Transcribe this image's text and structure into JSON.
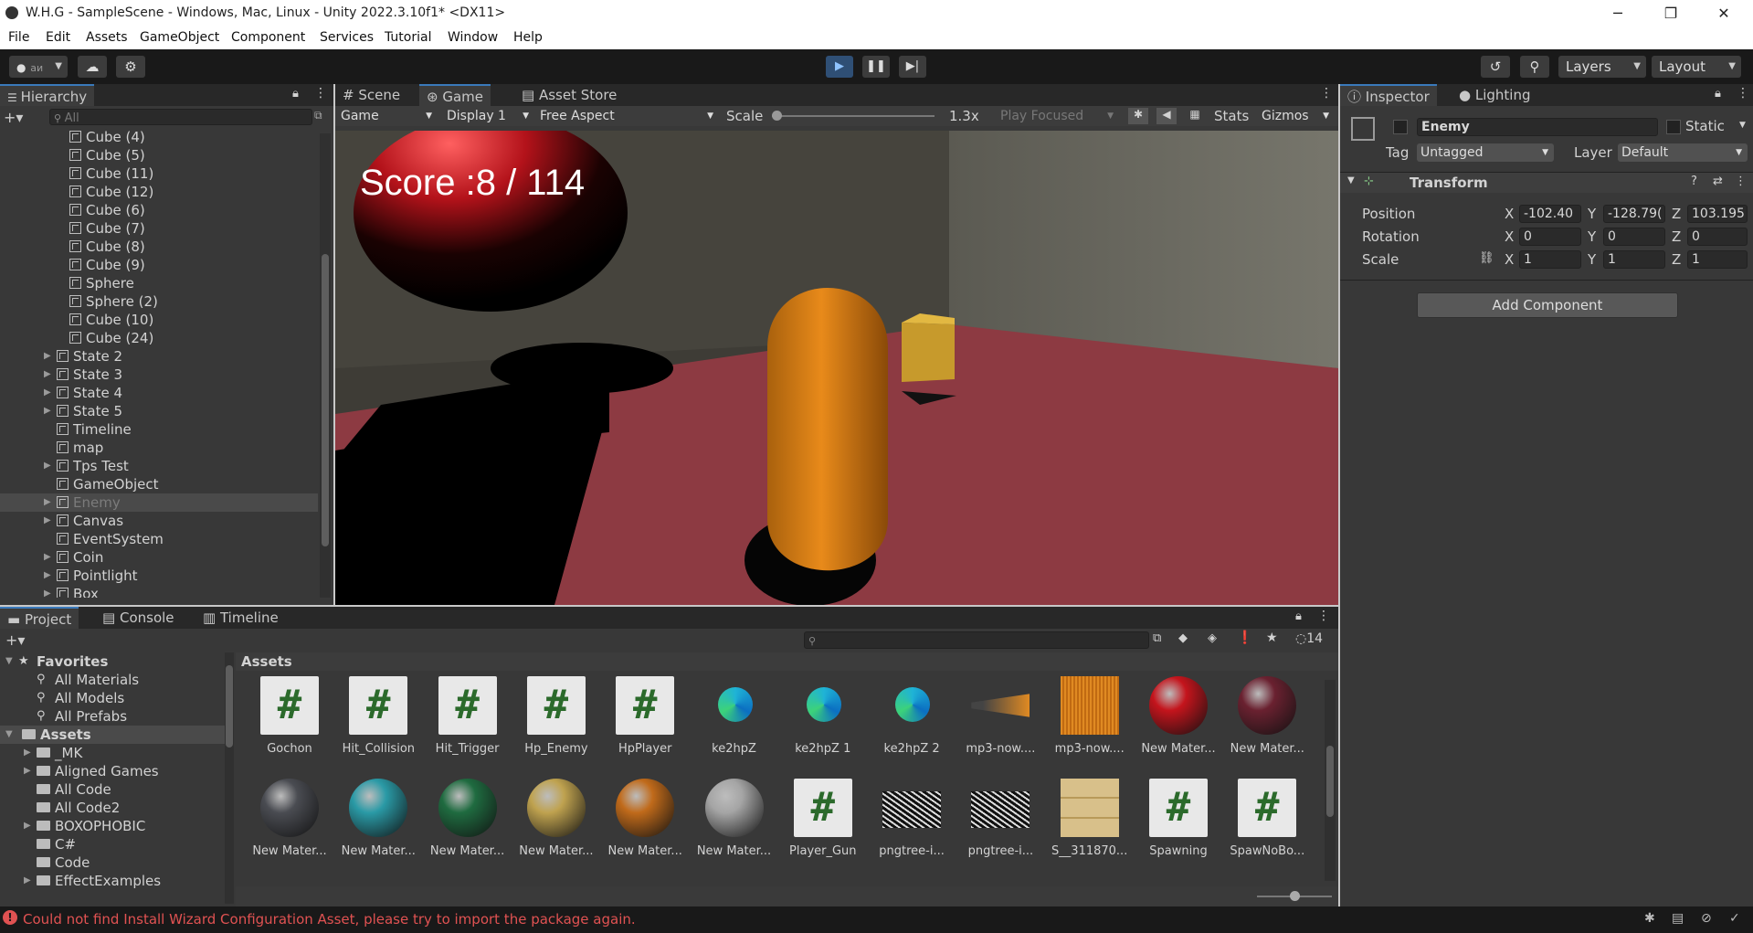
{
  "window": {
    "title": "W.H.G - SampleScene - Windows, Mac, Linux - Unity 2022.3.10f1* <DX11>"
  },
  "menu": [
    "File",
    "Edit",
    "Assets",
    "GameObject",
    "Component",
    "Services",
    "Tutorial",
    "Window",
    "Help"
  ],
  "toolbar": {
    "account": "aи",
    "layers": "Layers",
    "layout": "Layout"
  },
  "hierarchy": {
    "tab": "Hierarchy",
    "search_placeholder": "All",
    "rows": [
      {
        "label": "Cube (4)",
        "indent": 2,
        "expand": false
      },
      {
        "label": "Cube (5)",
        "indent": 2,
        "expand": false
      },
      {
        "label": "Cube (11)",
        "indent": 2,
        "expand": false
      },
      {
        "label": "Cube (12)",
        "indent": 2,
        "expand": false
      },
      {
        "label": "Cube (6)",
        "indent": 2,
        "expand": false
      },
      {
        "label": "Cube (7)",
        "indent": 2,
        "expand": false
      },
      {
        "label": "Cube (8)",
        "indent": 2,
        "expand": false
      },
      {
        "label": "Cube (9)",
        "indent": 2,
        "expand": false
      },
      {
        "label": "Sphere",
        "indent": 2,
        "expand": false
      },
      {
        "label": "Sphere (2)",
        "indent": 2,
        "expand": false
      },
      {
        "label": "Cube (10)",
        "indent": 2,
        "expand": false
      },
      {
        "label": "Cube (24)",
        "indent": 2,
        "expand": false
      },
      {
        "label": "State 2",
        "indent": 1,
        "expand": true
      },
      {
        "label": "State 3",
        "indent": 1,
        "expand": true
      },
      {
        "label": "State 4",
        "indent": 1,
        "expand": true
      },
      {
        "label": "State 5",
        "indent": 1,
        "expand": true
      },
      {
        "label": "Timeline",
        "indent": 1,
        "expand": false
      },
      {
        "label": "map",
        "indent": 1,
        "expand": false
      },
      {
        "label": "Tps Test",
        "indent": 1,
        "expand": true
      },
      {
        "label": "GameObject",
        "indent": 1,
        "expand": false
      },
      {
        "label": "Enemy",
        "indent": 1,
        "expand": true,
        "selected": true
      },
      {
        "label": "Canvas",
        "indent": 1,
        "expand": true
      },
      {
        "label": "EventSystem",
        "indent": 1,
        "expand": false
      },
      {
        "label": "Coin",
        "indent": 1,
        "expand": true
      },
      {
        "label": "Pointlight",
        "indent": 1,
        "expand": true
      },
      {
        "label": "Box",
        "indent": 1,
        "expand": true
      }
    ]
  },
  "viewport": {
    "tabs": [
      "Scene",
      "Game",
      "Asset Store"
    ],
    "game_dropdown": "Game",
    "display": "Display 1",
    "aspect": "Free Aspect",
    "scale_label": "Scale",
    "scale_value": "1.3x",
    "play_mode": "Play Focused",
    "stats": "Stats",
    "gizmos": "Gizmos",
    "score_text": "Score :8 / 114"
  },
  "inspector": {
    "tabs": [
      "Inspector",
      "Lighting"
    ],
    "object_name": "Enemy",
    "static_label": "Static",
    "tag_label": "Tag",
    "tag_value": "Untagged",
    "layer_label": "Layer",
    "layer_value": "Default",
    "component": "Transform",
    "position_label": "Position",
    "rotation_label": "Rotation",
    "scale_label": "Scale",
    "position": {
      "x": "-102.40",
      "y": "-128.79(",
      "z": "103.195"
    },
    "rotation": {
      "x": "0",
      "y": "0",
      "z": "0"
    },
    "scale": {
      "x": "1",
      "y": "1",
      "z": "1"
    },
    "add_component": "Add Component"
  },
  "project": {
    "tabs": [
      "Project",
      "Console",
      "Timeline"
    ],
    "hidden_count": "14",
    "breadcrumb": "Assets",
    "tree": [
      {
        "label": "Favorites",
        "kind": "header"
      },
      {
        "label": "All Materials",
        "kind": "search"
      },
      {
        "label": "All Models",
        "kind": "search"
      },
      {
        "label": "All Prefabs",
        "kind": "search"
      },
      {
        "label": "Assets",
        "kind": "root"
      },
      {
        "label": "_MK",
        "kind": "folder",
        "expand": true
      },
      {
        "label": "Aligned Games",
        "kind": "folder",
        "expand": true
      },
      {
        "label": "All Code",
        "kind": "folder",
        "expand": false
      },
      {
        "label": "All Code2",
        "kind": "folder",
        "expand": false
      },
      {
        "label": "BOXOPHOBIC",
        "kind": "folder",
        "expand": true
      },
      {
        "label": "C#",
        "kind": "folder",
        "expand": false
      },
      {
        "label": "Code",
        "kind": "folder",
        "expand": false
      },
      {
        "label": "EffectExamples",
        "kind": "folder",
        "expand": true
      }
    ],
    "assets_row1": [
      {
        "name": "Gochon",
        "kind": "script"
      },
      {
        "name": "Hit_Collision",
        "kind": "script"
      },
      {
        "name": "Hit_Trigger",
        "kind": "script"
      },
      {
        "name": "Hp_Enemy",
        "kind": "script"
      },
      {
        "name": "HpPlayer",
        "kind": "script"
      },
      {
        "name": "ke2hpZ",
        "kind": "edge"
      },
      {
        "name": "ke2hpZ 1",
        "kind": "edge"
      },
      {
        "name": "ke2hpZ 2",
        "kind": "edge"
      },
      {
        "name": "mp3-now....",
        "kind": "audio1"
      },
      {
        "name": "mp3-now....",
        "kind": "audio2"
      },
      {
        "name": "New Mater...",
        "kind": "sphere",
        "color": "#c4141c"
      },
      {
        "name": "New Mater...",
        "kind": "sphere",
        "color": "#6a2130"
      }
    ],
    "assets_row2": [
      {
        "name": "New Mater...",
        "kind": "sphere",
        "color": "#4a4c52"
      },
      {
        "name": "New Mater...",
        "kind": "sphere",
        "color": "#2a9aa6"
      },
      {
        "name": "New Mater...",
        "kind": "sphere",
        "color": "#1f6b40"
      },
      {
        "name": "New Mater...",
        "kind": "sphere",
        "color": "#bfa24f"
      },
      {
        "name": "New Mater...",
        "kind": "sphere",
        "color": "#c06a1a"
      },
      {
        "name": "New Mater...",
        "kind": "sphere",
        "color": "#a5a5a5"
      },
      {
        "name": "Player_Gun",
        "kind": "script"
      },
      {
        "name": "pngtree-i...",
        "kind": "maze"
      },
      {
        "name": "pngtree-i...",
        "kind": "maze"
      },
      {
        "name": "S__311870...",
        "kind": "photo"
      },
      {
        "name": "Spawning",
        "kind": "script"
      },
      {
        "name": "SpawNoBo...",
        "kind": "script"
      }
    ]
  },
  "status": {
    "message": "Could not find Install Wizard Configuration Asset, please try to import the package again."
  },
  "colors": {
    "accent": "#3a79bb",
    "error": "#e05252",
    "floor": "#8d3a42"
  }
}
